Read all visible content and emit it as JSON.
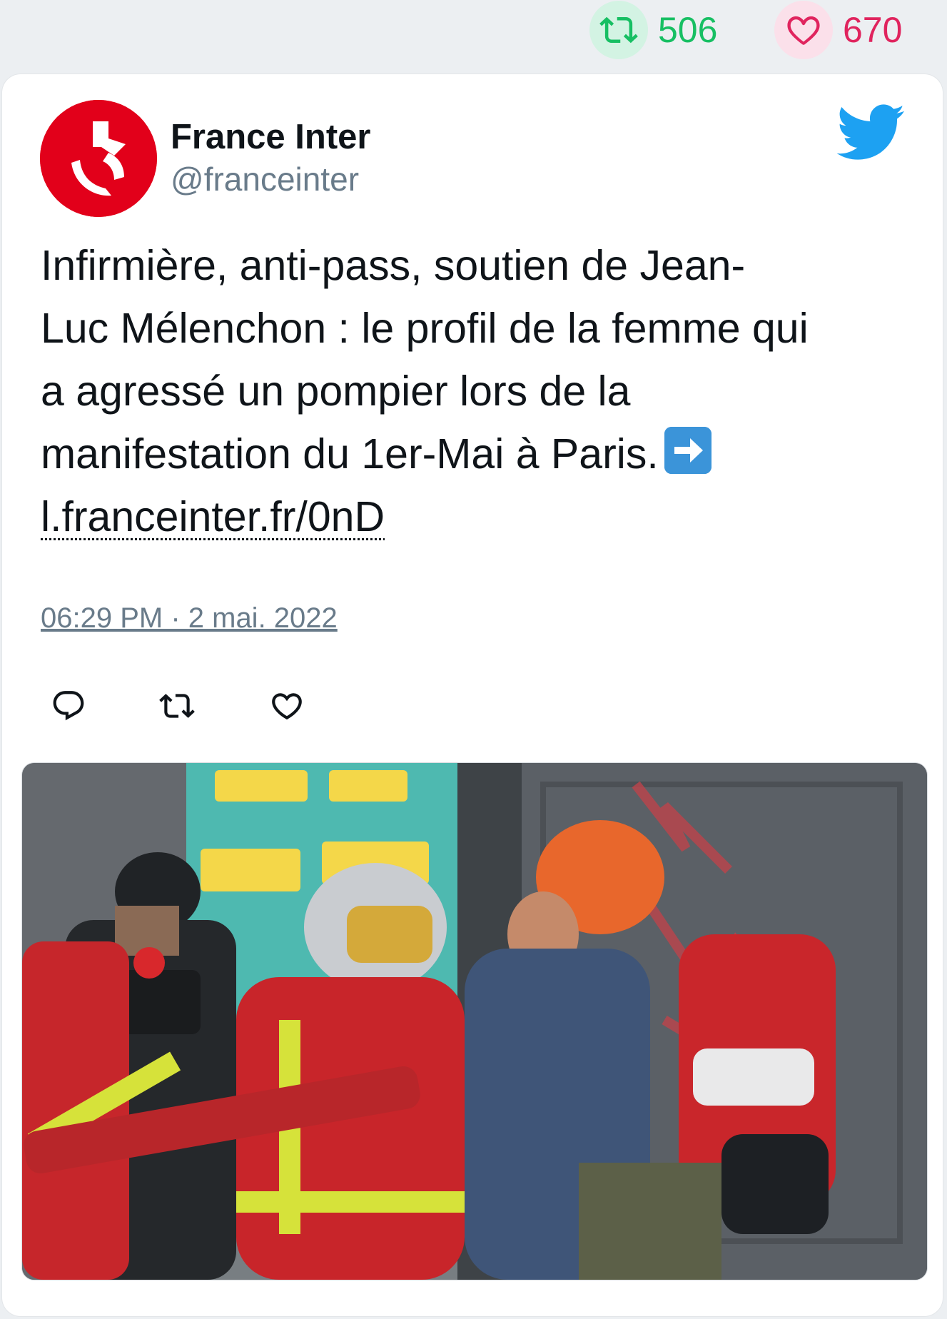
{
  "stats": {
    "retweets": "506",
    "likes": "670"
  },
  "tweet": {
    "author_name": "France Inter",
    "author_handle": "@franceinter",
    "text_lines": [
      "Infirmière, anti-pass, soutien de Jean-",
      "Luc Mélenchon : le profil de la femme qui",
      "a agressé un pompier lors de la",
      "manifestation du 1er-Mai à Paris."
    ],
    "link": "l.franceinter.fr/0nD",
    "timestamp": "06:29 PM · 2 mai. 2022"
  },
  "icons": {
    "retweet": "retweet-icon",
    "like": "heart-icon",
    "reply": "reply-icon",
    "brand": "twitter-bird-icon",
    "arrow": "right-arrow-emoji-icon"
  },
  "colors": {
    "retweet": "#17bf63",
    "like": "#e0245e",
    "twitter_blue": "#1da1f2",
    "avatar": "#e2001a"
  }
}
